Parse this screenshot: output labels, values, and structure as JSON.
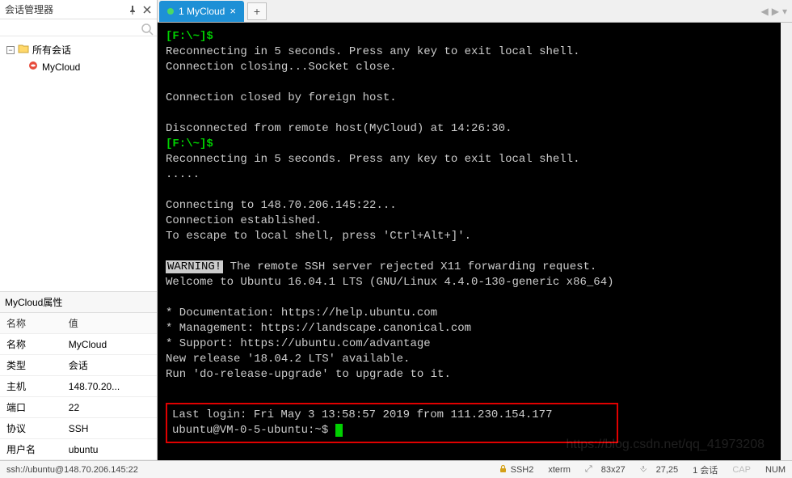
{
  "sidebar": {
    "title": "会话管理器",
    "root_label": "所有会话",
    "session_label": "MyCloud"
  },
  "props": {
    "title": "MyCloud属性",
    "header_name": "名称",
    "header_value": "值",
    "rows": [
      {
        "name": "名称",
        "value": "MyCloud"
      },
      {
        "name": "类型",
        "value": "会话"
      },
      {
        "name": "主机",
        "value": "148.70.20..."
      },
      {
        "name": "端口",
        "value": "22"
      },
      {
        "name": "协议",
        "value": "SSH"
      },
      {
        "name": "用户名",
        "value": "ubuntu"
      }
    ]
  },
  "tab": {
    "label": "1 MyCloud",
    "add": "+"
  },
  "terminal": {
    "prompt1": "[F:\\~]$ ",
    "line_reconnect": "Reconnecting in 5 seconds. Press any key to exit local shell.",
    "line_closing": "Connection closing...Socket close.",
    "line_closed": "Connection closed by foreign host.",
    "line_disconnected": "Disconnected from remote host(MyCloud) at 14:26:30.",
    "line_dots": ".....",
    "line_connecting": "Connecting to 148.70.206.145:22...",
    "line_established": "Connection established.",
    "line_escape": "To escape to local shell, press 'Ctrl+Alt+]'.",
    "warning_label": "WARNING!",
    "warning_rest": " The remote SSH server rejected X11 forwarding request.",
    "line_welcome": "Welcome to Ubuntu 16.04.1 LTS (GNU/Linux 4.4.0-130-generic x86_64)",
    "line_doc": " * Documentation:  https://help.ubuntu.com",
    "line_mgmt": " * Management:     https://landscape.canonical.com",
    "line_support": " * Support:        https://ubuntu.com/advantage",
    "line_newrelease": "New release '18.04.2 LTS' available.",
    "line_upgrade": "Run 'do-release-upgrade' to upgrade to it.",
    "line_lastlogin": "Last login: Fri May  3 13:58:57 2019 from 111.230.154.177",
    "shell_prompt": "ubuntu@VM-0-5-ubuntu:~$ ",
    "watermark": "https://blog.csdn.net/qq_41973208"
  },
  "status": {
    "left": "ssh://ubuntu@148.70.206.145:22",
    "ssh": "SSH2",
    "term": "xterm",
    "size": "83x27",
    "pos": "27,25",
    "sessions": "1 会话",
    "cap": "CAP",
    "num": "NUM"
  }
}
